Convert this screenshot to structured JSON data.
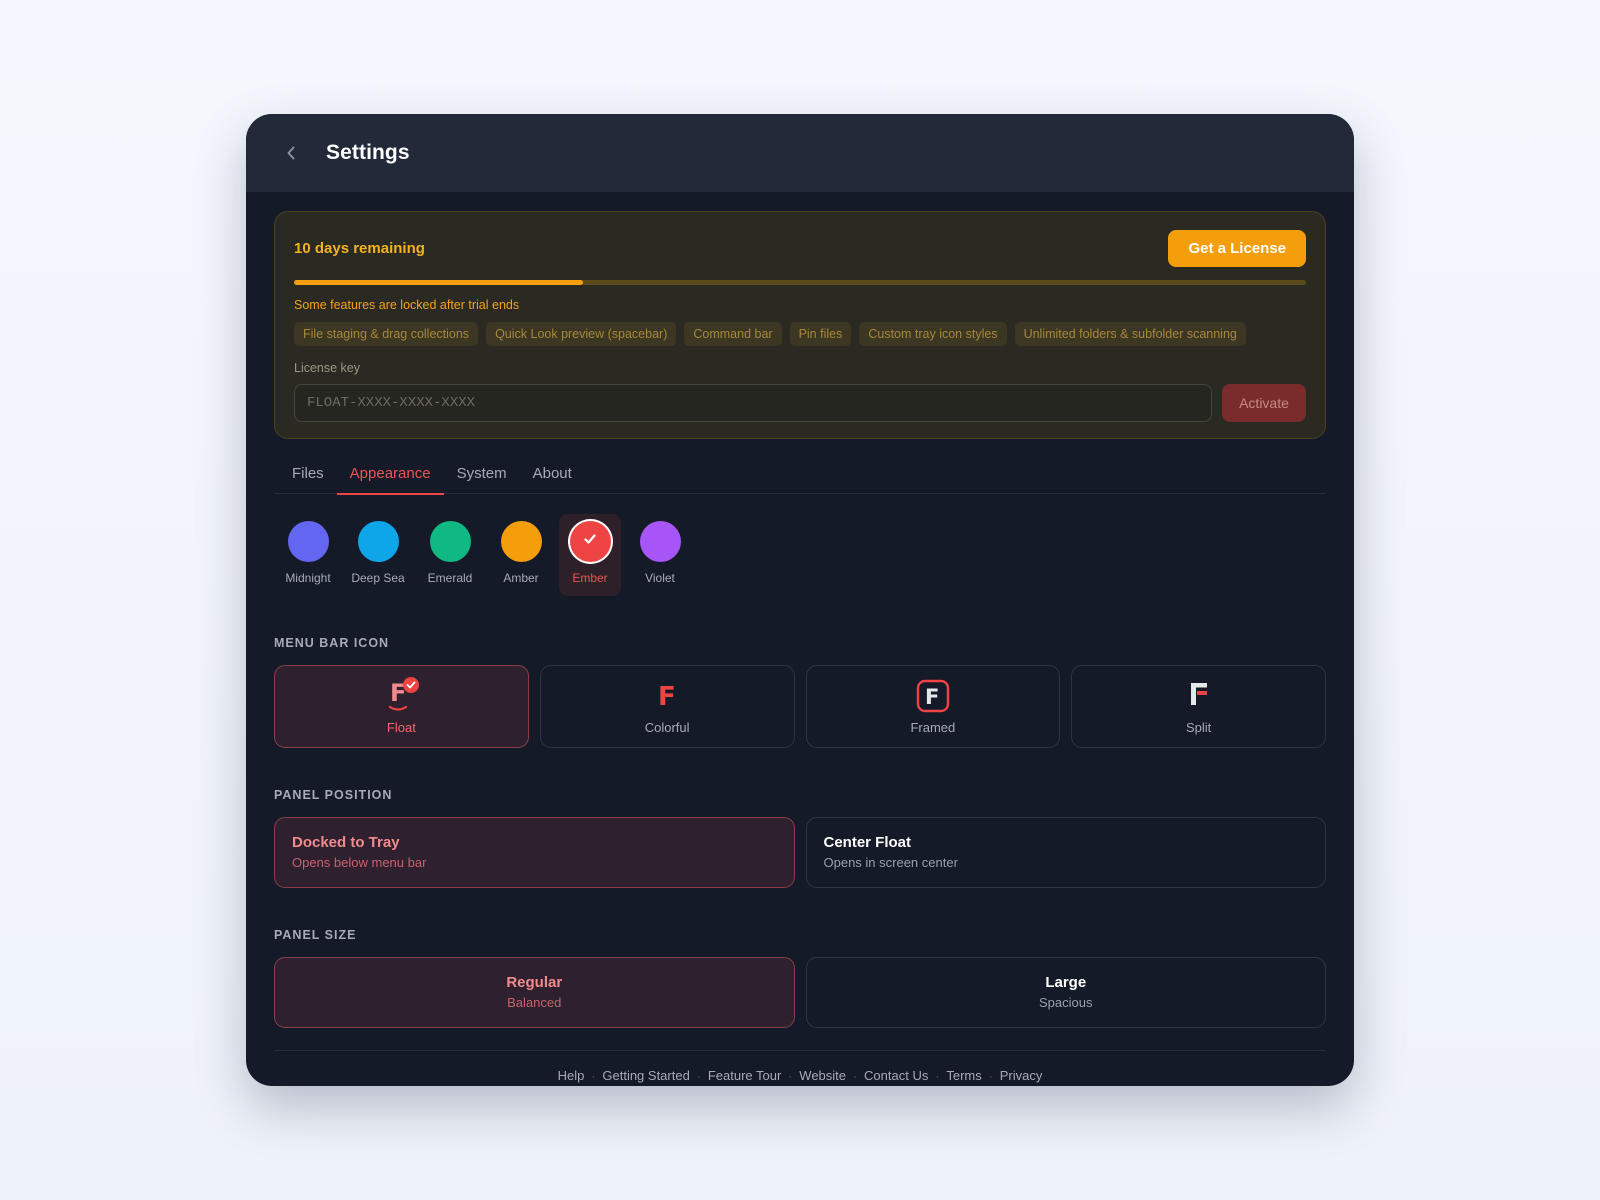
{
  "window": {
    "title": "Settings"
  },
  "trial": {
    "days_remaining": "10 days remaining",
    "get_license_label": "Get a License",
    "progress": 0.286,
    "locked_note": "Some features are locked after trial ends",
    "locked_features": [
      "File staging & drag collections",
      "Quick Look preview (spacebar)",
      "Command bar",
      "Pin files",
      "Custom tray icon styles",
      "Unlimited folders & subfolder scanning"
    ],
    "license_key_label": "License key",
    "license_key_placeholder": "FLOAT-XXXX-XXXX-XXXX",
    "license_key_value": "",
    "activate_label": "Activate"
  },
  "tabs": [
    {
      "label": "Files",
      "active": false
    },
    {
      "label": "Appearance",
      "active": true
    },
    {
      "label": "System",
      "active": false
    },
    {
      "label": "About",
      "active": false
    }
  ],
  "themes": [
    {
      "name": "Midnight",
      "color": "#6366f1",
      "selected": false
    },
    {
      "name": "Deep Sea",
      "color": "#0ea5e9",
      "selected": false
    },
    {
      "name": "Emerald",
      "color": "#10b981",
      "selected": false
    },
    {
      "name": "Amber",
      "color": "#f59e0b",
      "selected": false
    },
    {
      "name": "Ember",
      "color": "#ef4444",
      "selected": true
    },
    {
      "name": "Violet",
      "color": "#a855f7",
      "selected": false
    }
  ],
  "menu_bar_icon": {
    "section_title": "MENU BAR ICON",
    "options": [
      {
        "label": "Float",
        "icon": "float-f-icon",
        "selected": true
      },
      {
        "label": "Colorful",
        "icon": "colorful-f-icon",
        "selected": false
      },
      {
        "label": "Framed",
        "icon": "framed-f-icon",
        "selected": false
      },
      {
        "label": "Split",
        "icon": "split-f-icon",
        "selected": false
      }
    ]
  },
  "panel_position": {
    "section_title": "PANEL POSITION",
    "options": [
      {
        "title": "Docked to Tray",
        "subtitle": "Opens below menu bar",
        "selected": true
      },
      {
        "title": "Center Float",
        "subtitle": "Opens in screen center",
        "selected": false
      }
    ]
  },
  "panel_size": {
    "section_title": "PANEL SIZE",
    "options": [
      {
        "title": "Regular",
        "subtitle": "Balanced",
        "selected": true
      },
      {
        "title": "Large",
        "subtitle": "Spacious",
        "selected": false
      }
    ]
  },
  "footer": {
    "links": [
      "Help",
      "Getting Started",
      "Feature Tour",
      "Website",
      "Contact Us",
      "Terms",
      "Privacy"
    ],
    "separator": "·"
  },
  "colors": {
    "accent": "#ef4444",
    "trial_accent": "#f59e0b",
    "window_bg": "#141a27",
    "titlebar_bg": "#222a3a"
  }
}
